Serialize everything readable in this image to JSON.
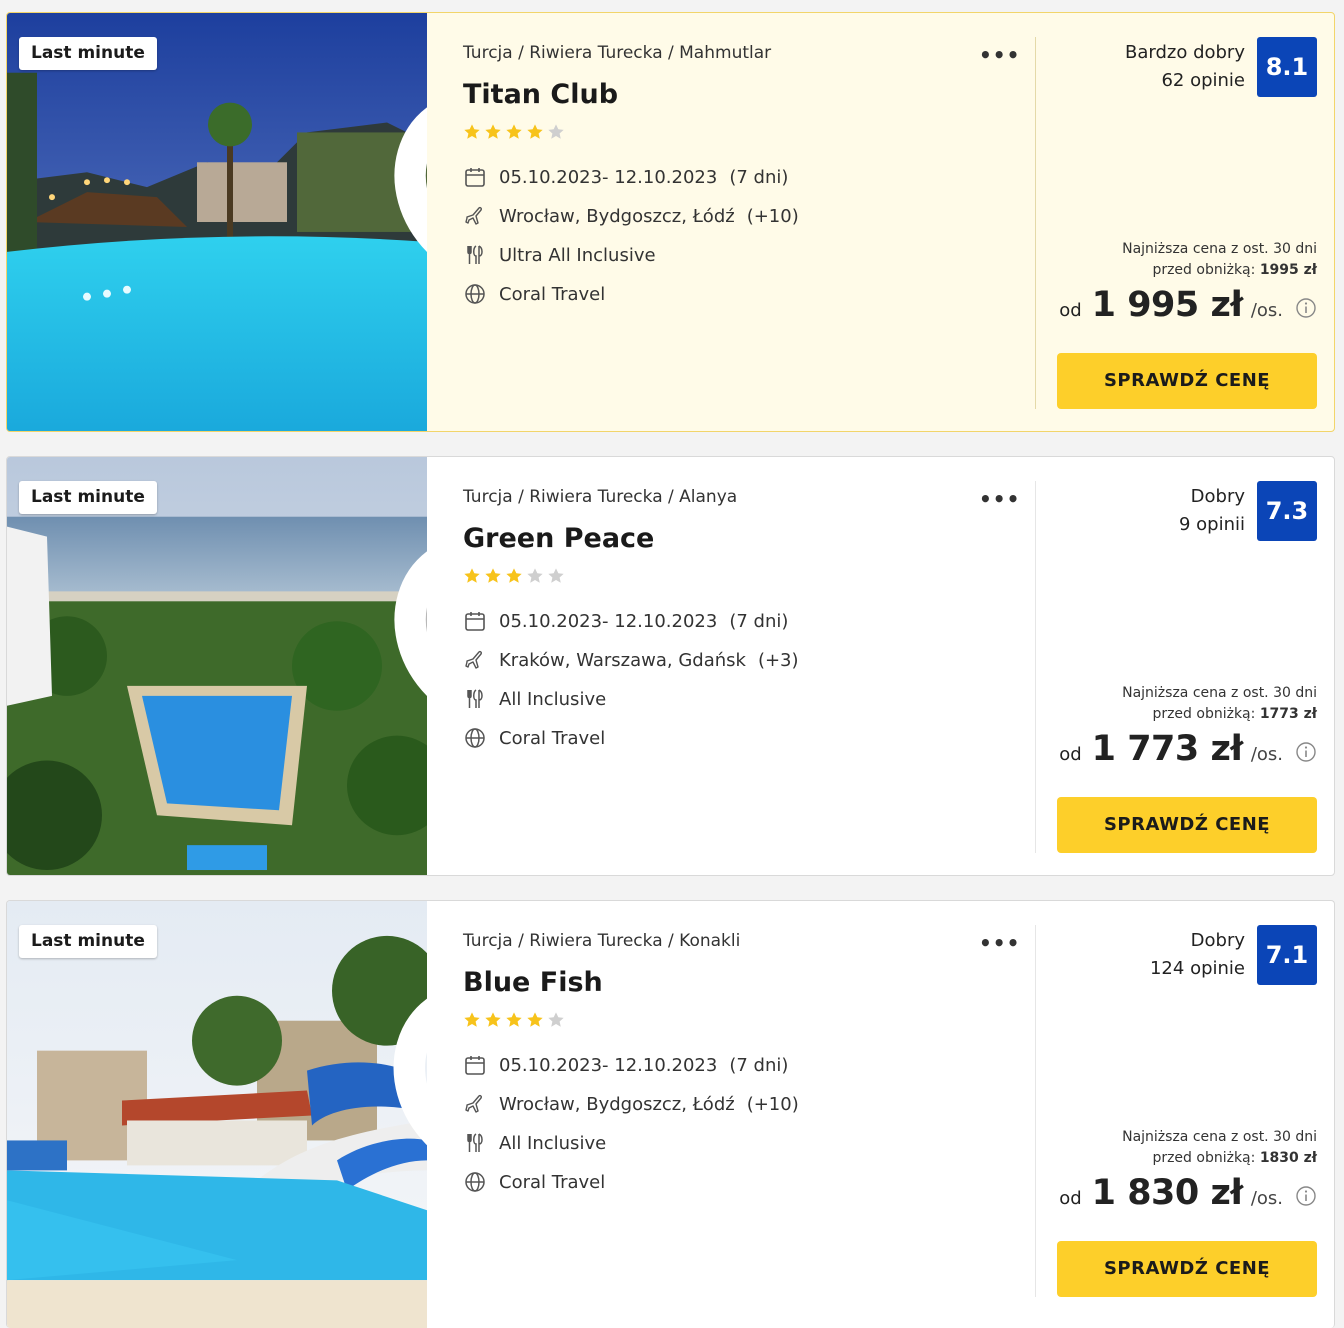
{
  "colors": {
    "accent": "#fdcf2a",
    "rating": "#0b45b7",
    "star_on": "#f7c31b",
    "star_off": "#cfcfcf"
  },
  "labels": {
    "lowest_line1": "Najniższa cena z ost. 30 dni",
    "lowest_line2": "przed obniżką:",
    "from": "od",
    "per_person": "/os.",
    "cta": "SPRAWDŹ CENĘ"
  },
  "offers": [
    {
      "badge": "Last minute",
      "favorite_icon": "heart-outline-icon",
      "breadcrumb": "Turcja / Riwiera Turecka / Mahmutlar",
      "name": "Titan Club",
      "stars": 4,
      "dates": "05.10.2023- 12.10.2023",
      "duration": "(7 dni)",
      "departures": "Wrocław, Bydgoszcz, Łódź",
      "departures_more": "(+10)",
      "board": "Ultra All Inclusive",
      "operator": "Coral Travel",
      "rating_label": "Bardzo dobry",
      "reviews": "62 opinie",
      "rating": "8.1",
      "lowest_price": "1995 zł",
      "price": "1 995 zł"
    },
    {
      "badge": "Last minute",
      "favorite_icon": "heart-filled-icon",
      "breadcrumb": "Turcja / Riwiera Turecka / Alanya",
      "name": "Green Peace",
      "stars": 3,
      "dates": "05.10.2023- 12.10.2023",
      "duration": "(7 dni)",
      "departures": "Kraków, Warszawa, Gdańsk",
      "departures_more": "(+3)",
      "board": "All Inclusive",
      "operator": "Coral Travel",
      "rating_label": "Dobry",
      "reviews": "9 opinii",
      "rating": "7.3",
      "lowest_price": "1773 zł",
      "price": "1 773 zł"
    },
    {
      "badge": "Last minute",
      "favorite_icon": "heart-outline-icon",
      "breadcrumb": "Turcja / Riwiera Turecka / Konakli",
      "name": "Blue Fish",
      "stars": 4,
      "dates": "05.10.2023- 12.10.2023",
      "duration": "(7 dni)",
      "departures": "Wrocław, Bydgoszcz, Łódź",
      "departures_more": "(+10)",
      "board": "All Inclusive",
      "operator": "Coral Travel",
      "rating_label": "Dobry",
      "reviews": "124 opinie",
      "rating": "7.1",
      "lowest_price": "1830 zł",
      "price": "1 830 zł"
    }
  ]
}
